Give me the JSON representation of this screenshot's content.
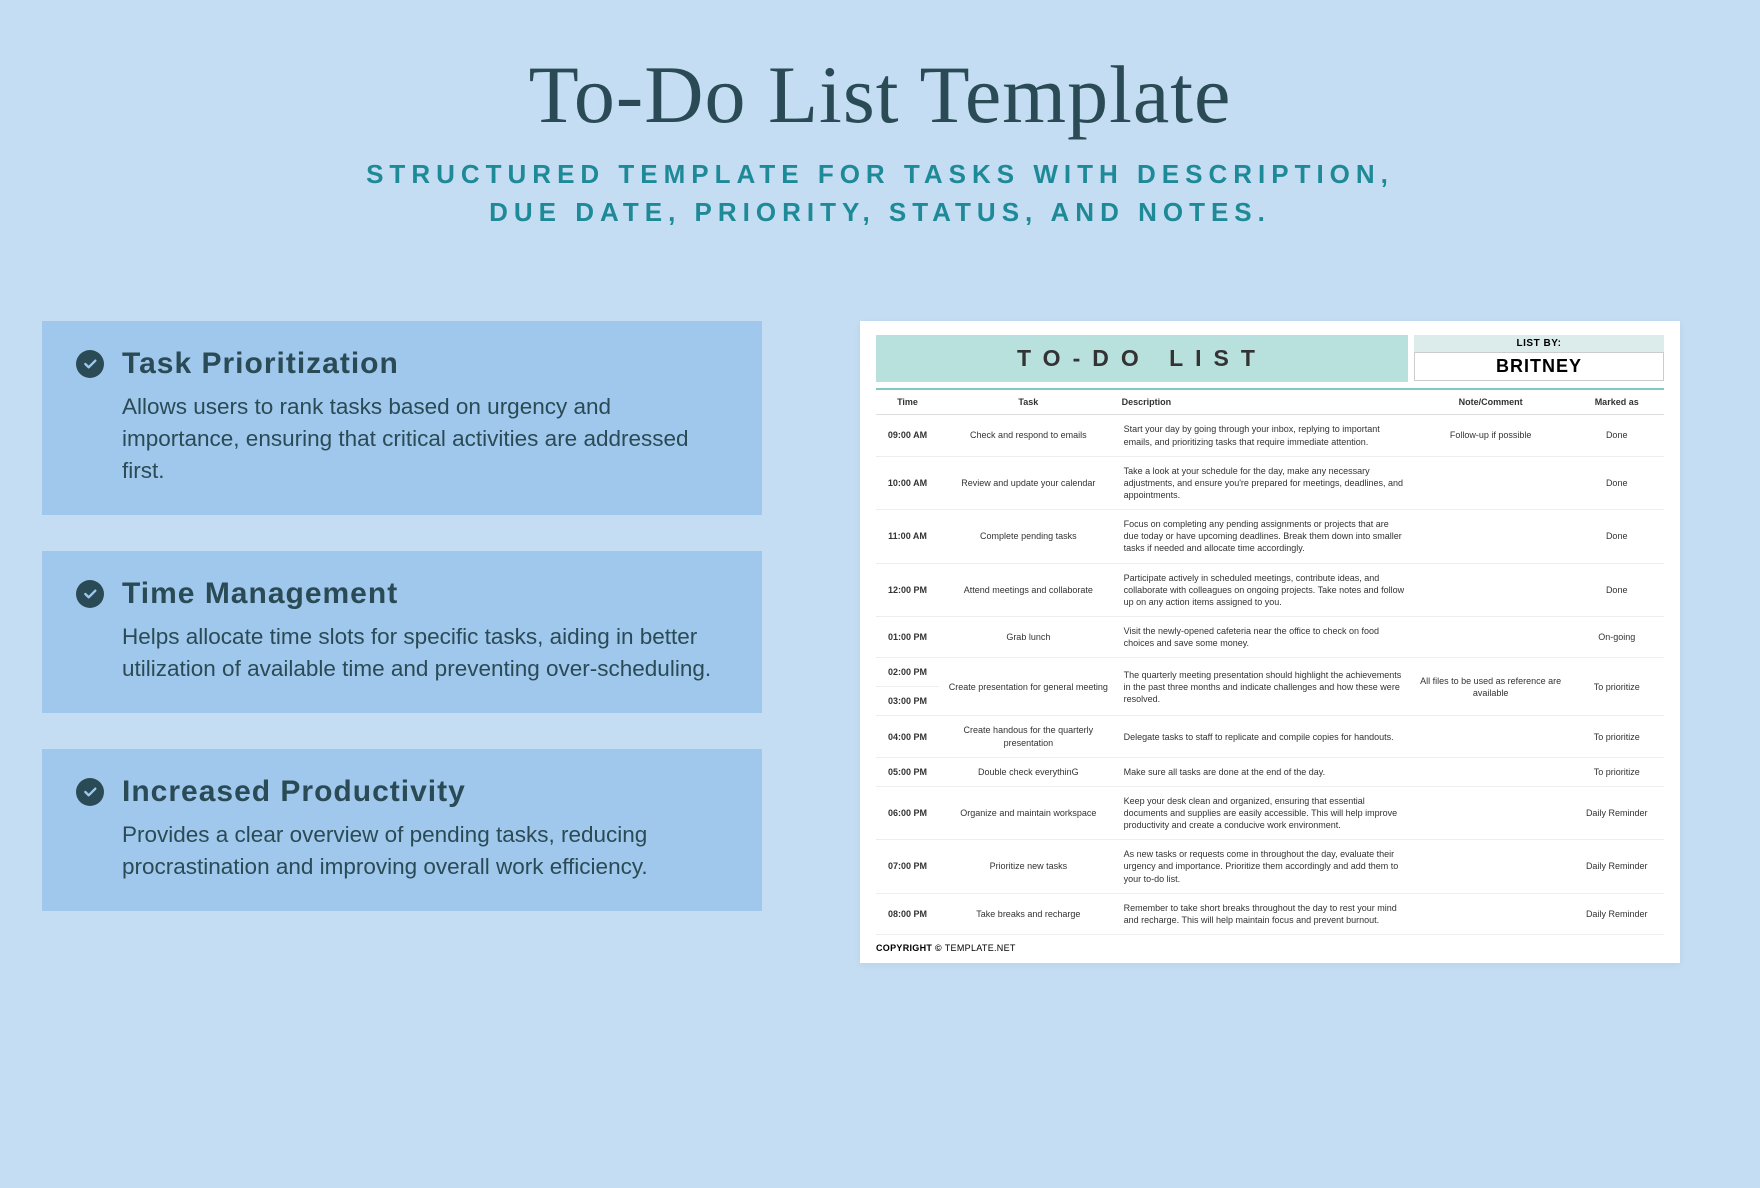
{
  "header": {
    "title": "To-Do List Template",
    "subtitle_line1": "STRUCTURED TEMPLATE FOR TASKS WITH DESCRIPTION,",
    "subtitle_line2": "DUE DATE, PRIORITY, STATUS, AND NOTES."
  },
  "features": [
    {
      "title": "Task Prioritization",
      "body": "Allows users to rank tasks based on urgency and importance, ensuring that critical activities are addressed first."
    },
    {
      "title": "Time Management",
      "body": " Helps allocate time slots for specific tasks, aiding in better utilization of available time and preventing over-scheduling."
    },
    {
      "title": "Increased Productivity",
      "body": "Provides a clear overview of pending tasks, reducing procrastination and improving overall work efficiency."
    }
  ],
  "doc": {
    "title": "TO-DO LIST",
    "list_by_label": "LIST BY:",
    "list_by_value": "BRITNEY",
    "columns": [
      "Time",
      "Task",
      "Description",
      "Note/Comment",
      "Marked as"
    ],
    "rows": [
      {
        "time": "09:00 AM",
        "task": "Check and respond to emails",
        "desc": "Start your day by going through your inbox, replying to important emails, and prioritizing tasks that require immediate attention.",
        "note": "Follow-up if possible",
        "mark": "Done",
        "mark_class": "mark-done"
      },
      {
        "time": "10:00 AM",
        "task": "Review and update your calendar",
        "desc": "Take a look at your schedule for the day, make any necessary adjustments, and ensure you're prepared for meetings, deadlines, and appointments.",
        "note": "",
        "mark": "Done",
        "mark_class": "mark-done"
      },
      {
        "time": "11:00 AM",
        "task": "Complete pending tasks",
        "desc": "Focus on completing any pending assignments or projects that are due today or have upcoming deadlines. Break them down into smaller tasks if needed and allocate time accordingly.",
        "note": "",
        "mark": "Done",
        "mark_class": "mark-done"
      },
      {
        "time": "12:00 PM",
        "task": "Attend meetings and collaborate",
        "desc": "Participate actively in scheduled meetings, contribute ideas, and collaborate with colleagues on ongoing projects. Take notes and follow up on any action items assigned to you.",
        "note": "",
        "mark": "Done",
        "mark_class": "mark-done"
      },
      {
        "time": "01:00 PM",
        "task": "Grab lunch",
        "desc": "Visit the newly-opened cafeteria near the office to check on food choices and save some money.",
        "note": "",
        "mark": "On-going",
        "mark_class": "mark-ongoing"
      },
      {
        "time": "02:00 PM",
        "task": "",
        "desc": "",
        "note": "",
        "mark": "",
        "mark_class": "",
        "merge_start": true
      },
      {
        "time": "03:00 PM",
        "task": "Create presentation for general meeting",
        "desc": "The quarterly meeting presentation should highlight the achievements in the past three months and indicate challenges and how these were resolved.",
        "note": "All files to be used as reference are available",
        "mark": "To prioritize",
        "mark_class": "mark-prior",
        "merge_end": true
      },
      {
        "time": "04:00 PM",
        "task": "Create handous for the quarterly presentation",
        "desc": "Delegate tasks to staff to replicate and compile copies for handouts.",
        "note": "",
        "mark": "To prioritize",
        "mark_class": "mark-prior"
      },
      {
        "time": "05:00 PM",
        "task": "Double check everythinG",
        "desc": "Make sure all tasks are done at the end of the day.",
        "note": "",
        "mark": "To prioritize",
        "mark_class": "mark-prior"
      },
      {
        "time": "06:00 PM",
        "task": "Organize and maintain workspace",
        "desc": "Keep your desk clean and organized, ensuring that essential documents and supplies are easily accessible. This will help improve productivity and create a conducive work environment.",
        "note": "",
        "mark": "Daily Reminder",
        "mark_class": "mark-daily"
      },
      {
        "time": "07:00 PM",
        "task": "Prioritize new tasks",
        "desc": "As new tasks or requests come in throughout the day, evaluate their urgency and importance. Prioritize them accordingly and add them to your to-do list.",
        "note": "",
        "mark": "Daily Reminder",
        "mark_class": "mark-daily"
      },
      {
        "time": "08:00 PM",
        "task": "Take breaks and recharge",
        "desc": "Remember to take short breaks throughout the day to rest your mind and recharge. This will help maintain focus and prevent burnout.",
        "note": "",
        "mark": "Daily Reminder",
        "mark_class": "mark-daily"
      }
    ],
    "footer_prefix": "COPYRIGHT © ",
    "footer_brand": "TEMPLATE.NET"
  }
}
